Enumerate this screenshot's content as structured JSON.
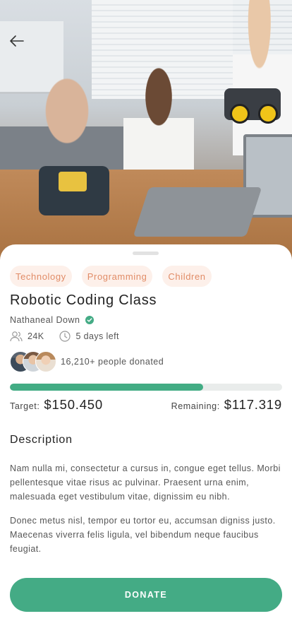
{
  "hero": {
    "image_alt": "Man and children building robots with a laptop",
    "back_icon": "arrow-left-icon"
  },
  "campaign": {
    "tags": [
      "Technology",
      "Programming",
      "Children"
    ],
    "title": "Robotic Coding Class",
    "author": "Nathaneal Down",
    "verified_icon": "check-circle-icon",
    "followers": "24K",
    "time_left": "5 days left",
    "donors_text": "16,210+ people donated",
    "progress": 0.71,
    "target_label": "Target:",
    "target_value": "$150.450",
    "remaining_label": "Remaining:",
    "remaining_value": "$117.319"
  },
  "description": {
    "heading": "Description",
    "paragraphs": [
      "Nam nulla mi, consectetur a cursus in, congue eget tellus. Morbi pellentesque vitae risus ac pulvinar. Praesent urna enim, malesuada eget vestibulum vitae, dignissim eu nibh.",
      "Donec metus nisl, tempor eu tortor eu, accumsan digniss justo. Maecenas viverra felis ligula, vel bibendum neque faucibus feugiat."
    ]
  },
  "actions": {
    "donate_label": "DONATE"
  },
  "colors": {
    "accent": "#44ab85",
    "tag_text": "#e18c67",
    "tag_bg": "#fdf0ea"
  }
}
